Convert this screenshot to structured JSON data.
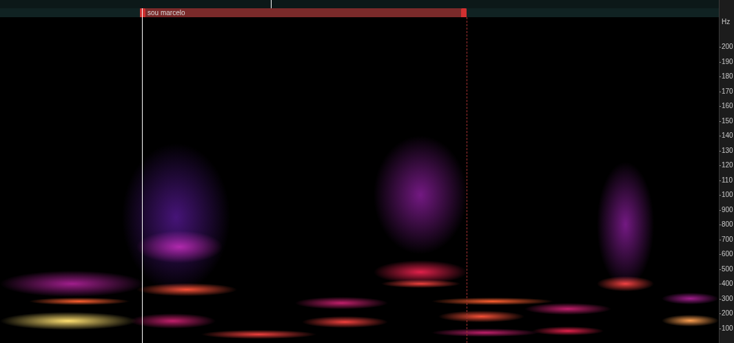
{
  "label_track": {
    "label": "sou marcelo",
    "start": 0.1947,
    "end": 0.6495
  },
  "selection": {
    "start": 0.1975,
    "end": 0.649
  },
  "playhead": {
    "position": 0.377
  },
  "axis": {
    "unit": "Hz",
    "ticks": [
      {
        "text": "200",
        "hz": 2000
      },
      {
        "text": "190",
        "hz": 1900
      },
      {
        "text": "180",
        "hz": 1800
      },
      {
        "text": "170",
        "hz": 1700
      },
      {
        "text": "160",
        "hz": 1600
      },
      {
        "text": "150",
        "hz": 1500
      },
      {
        "text": "140",
        "hz": 1400
      },
      {
        "text": "130",
        "hz": 1300
      },
      {
        "text": "120",
        "hz": 1200
      },
      {
        "text": "110",
        "hz": 1100
      },
      {
        "text": "100",
        "hz": 1000
      },
      {
        "text": "900",
        "hz": 900
      },
      {
        "text": "800",
        "hz": 800
      },
      {
        "text": "700",
        "hz": 700
      },
      {
        "text": "600",
        "hz": 600
      },
      {
        "text": "500",
        "hz": 500
      },
      {
        "text": "400",
        "hz": 400
      },
      {
        "text": "300",
        "hz": 300
      },
      {
        "text": "200",
        "hz": 200
      },
      {
        "text": "100",
        "hz": 100
      }
    ]
  },
  "spectrogram": {
    "f_max": 2200,
    "bands": [
      {
        "t0": 0.0,
        "t1": 0.2,
        "f": 400,
        "bw": 180,
        "intensity": 0.5
      },
      {
        "t0": 0.0,
        "t1": 0.19,
        "f": 150,
        "bw": 120,
        "intensity": 1.0
      },
      {
        "t0": 0.04,
        "t1": 0.18,
        "f": 280,
        "bw": 50,
        "intensity": 0.9
      },
      {
        "t0": 0.17,
        "t1": 0.32,
        "f": 850,
        "bw": 1000,
        "intensity": 0.3
      },
      {
        "t0": 0.19,
        "t1": 0.31,
        "f": 650,
        "bw": 220,
        "intensity": 0.5
      },
      {
        "t0": 0.19,
        "t1": 0.33,
        "f": 360,
        "bw": 90,
        "intensity": 0.85
      },
      {
        "t0": 0.18,
        "t1": 0.3,
        "f": 150,
        "bw": 100,
        "intensity": 0.6
      },
      {
        "t0": 0.28,
        "t1": 0.44,
        "f": 60,
        "bw": 60,
        "intensity": 0.8
      },
      {
        "t0": 0.41,
        "t1": 0.54,
        "f": 270,
        "bw": 80,
        "intensity": 0.6
      },
      {
        "t0": 0.42,
        "t1": 0.54,
        "f": 140,
        "bw": 80,
        "intensity": 0.8
      },
      {
        "t0": 0.52,
        "t1": 0.65,
        "f": 1000,
        "bw": 800,
        "intensity": 0.4
      },
      {
        "t0": 0.52,
        "t1": 0.65,
        "f": 480,
        "bw": 160,
        "intensity": 0.7
      },
      {
        "t0": 0.53,
        "t1": 0.64,
        "f": 400,
        "bw": 60,
        "intensity": 0.8
      },
      {
        "t0": 0.6,
        "t1": 0.77,
        "f": 280,
        "bw": 50,
        "intensity": 0.9
      },
      {
        "t0": 0.61,
        "t1": 0.73,
        "f": 180,
        "bw": 80,
        "intensity": 0.85
      },
      {
        "t0": 0.6,
        "t1": 0.75,
        "f": 70,
        "bw": 60,
        "intensity": 0.6
      },
      {
        "t0": 0.73,
        "t1": 0.85,
        "f": 230,
        "bw": 80,
        "intensity": 0.6
      },
      {
        "t0": 0.74,
        "t1": 0.84,
        "f": 80,
        "bw": 60,
        "intensity": 0.7
      },
      {
        "t0": 0.83,
        "t1": 0.91,
        "f": 800,
        "bw": 850,
        "intensity": 0.4
      },
      {
        "t0": 0.83,
        "t1": 0.91,
        "f": 400,
        "bw": 100,
        "intensity": 0.8
      },
      {
        "t0": 0.92,
        "t1": 1.0,
        "f": 150,
        "bw": 80,
        "intensity": 0.95
      },
      {
        "t0": 0.92,
        "t1": 1.0,
        "f": 300,
        "bw": 80,
        "intensity": 0.5
      }
    ]
  }
}
